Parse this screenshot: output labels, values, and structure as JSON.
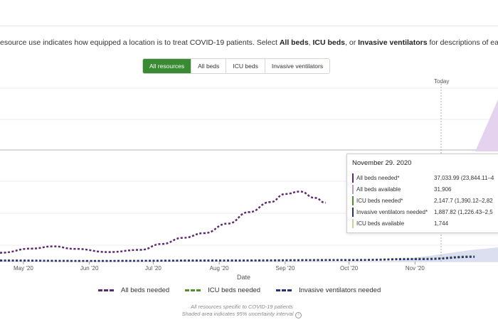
{
  "intro": {
    "part1": "esource use indicates how equipped a location is to treat COVID-19 patients. Select ",
    "bold1": "All beds",
    "sep1": ", ",
    "bold2": "ICU beds",
    "sep2": ", or ",
    "bold3": "Invasive ventilators",
    "part2": " for descriptions of each mea"
  },
  "tabs": [
    {
      "label": "All resources",
      "active": true
    },
    {
      "label": "All beds",
      "active": false
    },
    {
      "label": "ICU beds",
      "active": false
    },
    {
      "label": "Invasive ventilators",
      "active": false
    }
  ],
  "today_label": "Today",
  "chart_data": {
    "type": "line",
    "x_axis_label": "Date",
    "x_ticks": [
      "May '20",
      "Jun '20",
      "Jul '20",
      "Aug '20",
      "Sep '20",
      "Oct '20",
      "Nov '20"
    ],
    "series": [
      {
        "name": "All beds needed",
        "color": "#5c2a6e",
        "dash": "dashed",
        "x": [
          "2020-04-20",
          "2020-05-05",
          "2020-05-15",
          "2020-05-25",
          "2020-06-10",
          "2020-06-25",
          "2020-07-05",
          "2020-07-15",
          "2020-07-25",
          "2020-08-05",
          "2020-08-15",
          "2020-08-25",
          "2020-09-01",
          "2020-09-08",
          "2020-09-15",
          "2020-09-20"
        ],
        "values": [
          3600,
          5300,
          6200,
          5200,
          3900,
          4800,
          7200,
          9700,
          11600,
          15500,
          20200,
          24300,
          27600,
          28600,
          26000,
          24000
        ]
      },
      {
        "name": "ICU beds needed",
        "color": "#4f8f2f",
        "dash": "dashed",
        "x": [
          "2020-04-20",
          "2020-06-01",
          "2020-08-01",
          "2020-10-01",
          "2020-11-05",
          "2020-11-29"
        ],
        "values": [
          500,
          300,
          500,
          700,
          1200,
          2147.7
        ]
      },
      {
        "name": "Invasive ventilators needed",
        "color": "#2b2f7a",
        "dash": "dashed",
        "x": [
          "2020-04-20",
          "2020-06-01",
          "2020-08-01",
          "2020-10-01",
          "2020-11-05",
          "2020-11-29"
        ],
        "values": [
          400,
          250,
          400,
          600,
          1000,
          1887.82
        ]
      }
    ]
  },
  "legend": [
    {
      "label": "All beds needed",
      "color": "#5c2a6e"
    },
    {
      "label": "ICU beds needed",
      "color": "#4f8f2f"
    },
    {
      "label": "Invasive ventilators needed",
      "color": "#2b2f7a"
    }
  ],
  "notes": {
    "line1": "All resources specific to COVID-19 patients",
    "line2": "Shaded area indicates 95% uncertainty interval"
  },
  "tooltip": {
    "date": "November 29. 2020",
    "rows": [
      {
        "label": "All beds needed*",
        "value": "37,033.99 (23,844.11–4",
        "color": "#5c2a6e"
      },
      {
        "label": "All beds available",
        "value": "31,906",
        "color": "#b79cc9"
      },
      {
        "label": "ICU beds needed*",
        "value": "2,147.7 (1,390.12–2,82",
        "color": "#4f8f2f"
      },
      {
        "label": "Invasive ventilators needed*",
        "value": "1,887.82 (1,226.43–2,5",
        "color": "#2b2f7a"
      },
      {
        "label": "ICU beds available",
        "value": "1,744",
        "color": "#c9d49a"
      }
    ]
  }
}
